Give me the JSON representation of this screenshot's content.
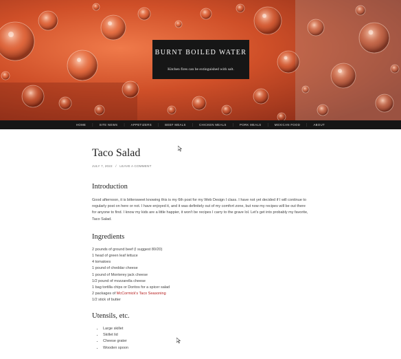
{
  "site": {
    "title": "BURNT BOILED WATER",
    "tagline": "Kitchen fires can be extinguished with salt."
  },
  "nav": {
    "items": [
      "Home",
      "Site News",
      "Appetizers",
      "Beef Meals",
      "Chicken Meals",
      "Pork Meals",
      "Mexican Food",
      "About"
    ]
  },
  "post": {
    "title": "Taco Salad",
    "date": "JULY 7, 2022",
    "meta_sep": "/",
    "comment_link": "LEAVE A COMMENT",
    "intro_heading": "Introduction",
    "intro_text": "Good afternoon, it is bittersweet knowing this is my 6th post for my Web Design I class. I have not yet decided if I will continue to regularly post on here or not. I have enjoyed it, and it was definitely out of my comfort zone, but now my recipes will be out there for anyone to find. I know my kids are a little happier, it won't be recipes I carry to the grave lol. Let's get into probably my favorite, Taco Salad.",
    "ingredients_heading": "Ingredients",
    "ingredients": [
      "2 pounds of ground beef (I suggest 80/20)",
      "1 head of green leaf lettuce",
      "4 tomatoes",
      "1 pound of cheddar cheese",
      "1 pound of Monterey jack cheese",
      "1/2 pound of mozzarella cheese",
      "1 bag tortilla chips or Doritos for a spicer salad"
    ],
    "seasoning_prefix": "2 packages of ",
    "seasoning_link": "McCormick's Taco Seasoning",
    "butter": "1/2 stick of butter",
    "utensils_heading": "Utensils, etc.",
    "utensils": [
      "Large skillet",
      "Skillet lid",
      "Cheese grater",
      "Wooden spoon"
    ]
  },
  "colors": {
    "header_bg": "#161616",
    "link": "#b51c1c",
    "hero_orange": "#d4562c"
  }
}
